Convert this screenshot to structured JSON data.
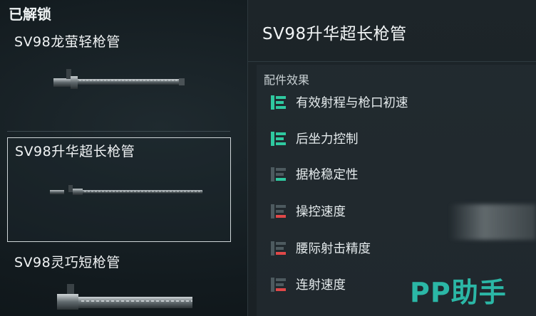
{
  "section_title": "已解锁",
  "items": [
    {
      "name": "SV98龙萤轻枪管",
      "selected": false
    },
    {
      "name": "SV98升华超长枪管",
      "selected": true
    },
    {
      "name": "SV98灵巧短枪管",
      "selected": false
    }
  ],
  "detail": {
    "title": "SV98升华超长枪管",
    "effects_header": "配件效果",
    "effects": [
      {
        "label": "有效射程与枪口初速",
        "icon": "stat-up-strong-icon",
        "color": "#2fc9a0"
      },
      {
        "label": "后坐力控制",
        "icon": "stat-up-strong-icon",
        "color": "#2fc9a0"
      },
      {
        "label": "据枪稳定性",
        "icon": "stat-up-weak-icon",
        "color": "#2fc9a0"
      },
      {
        "label": "操控速度",
        "icon": "stat-down-icon",
        "color": "#e04848"
      },
      {
        "label": "腰际射击精度",
        "icon": "stat-down-icon",
        "color": "#e04848"
      },
      {
        "label": "连射速度",
        "icon": "stat-down-icon",
        "color": "#e04848"
      }
    ]
  },
  "watermark": "PP助手"
}
